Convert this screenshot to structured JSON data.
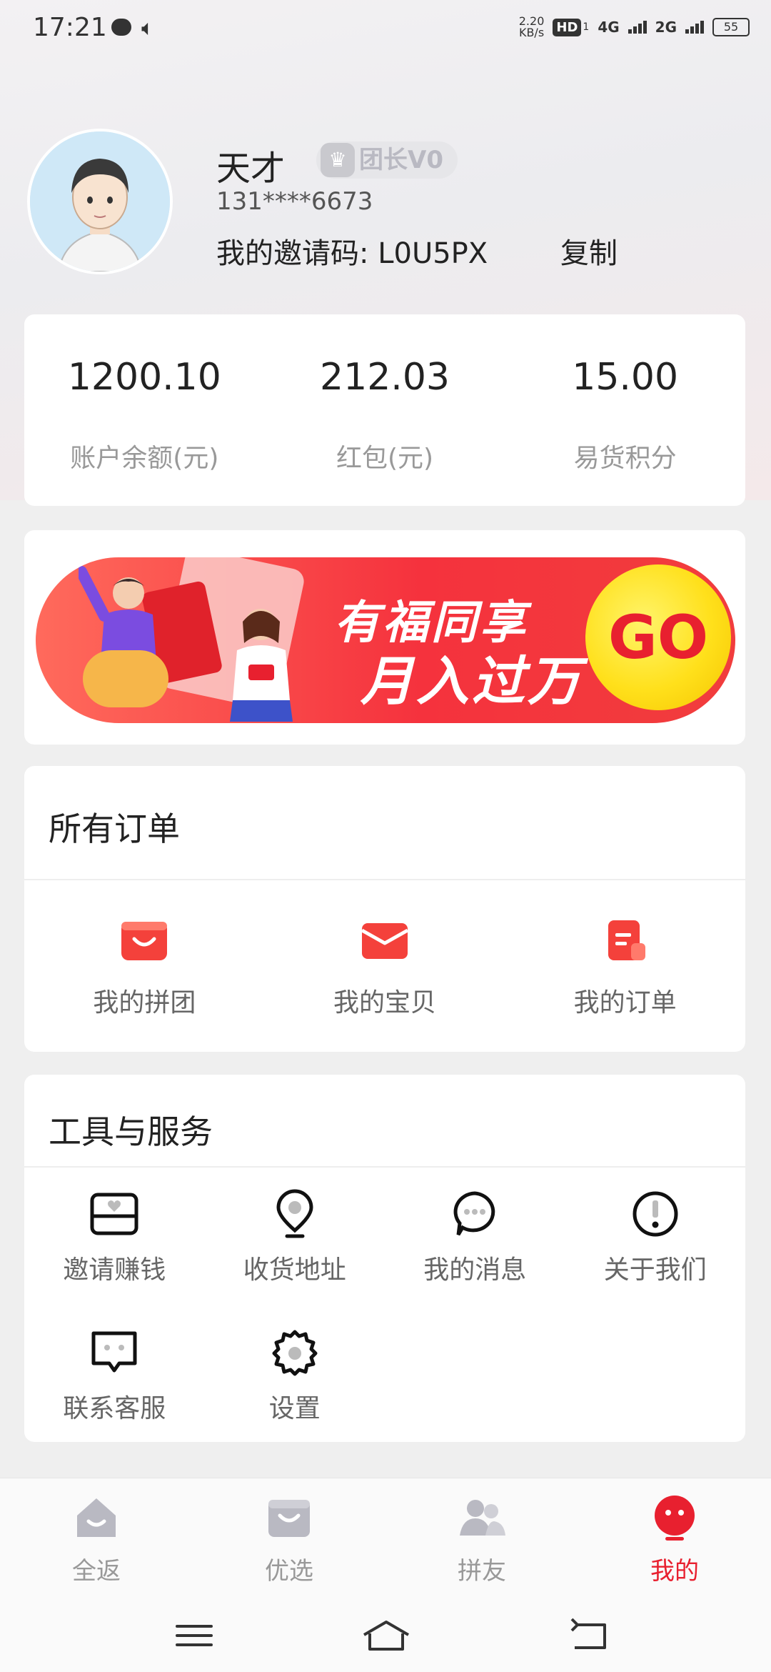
{
  "status_bar": {
    "time": "17:21",
    "net_speed": "2.20",
    "net_unit": "KB/s",
    "hd": "HD",
    "sim1": "1",
    "net_4g": "4G",
    "net_2g": "2G",
    "battery": "55"
  },
  "profile": {
    "name": "天才",
    "level_badge": "团长V0",
    "phone": "131****6673",
    "invite_label": "我的邀请码:",
    "invite_code": "L0U5PX",
    "copy_label": "复制"
  },
  "stats": [
    {
      "value": "1200.10",
      "label": "账户余额(元)"
    },
    {
      "value": "212.03",
      "label": "红包(元)"
    },
    {
      "value": "15.00",
      "label": "易货积分"
    }
  ],
  "banner": {
    "line1": "有福同享",
    "line2": "月入过万",
    "go": "GO"
  },
  "orders": {
    "title": "所有订单",
    "items": [
      {
        "label": "我的拼团",
        "icon": "group-buy-bag-icon"
      },
      {
        "label": "我的宝贝",
        "icon": "treasure-box-icon"
      },
      {
        "label": "我的订单",
        "icon": "order-list-icon"
      }
    ]
  },
  "tools": {
    "title": "工具与服务",
    "items": [
      {
        "label": "邀请赚钱",
        "icon": "invite-envelope-icon"
      },
      {
        "label": "收货地址",
        "icon": "location-pin-icon"
      },
      {
        "label": "我的消息",
        "icon": "message-bubble-icon"
      },
      {
        "label": "关于我们",
        "icon": "info-exclamation-icon"
      },
      {
        "label": "联系客服",
        "icon": "customer-service-icon"
      },
      {
        "label": "设置",
        "icon": "settings-gear-icon"
      }
    ]
  },
  "nav": {
    "items": [
      {
        "label": "全返",
        "icon": "home-icon"
      },
      {
        "label": "优选",
        "icon": "shopping-bag-icon"
      },
      {
        "label": "拼友",
        "icon": "friends-icon"
      },
      {
        "label": "我的",
        "icon": "profile-face-icon"
      }
    ],
    "active": "我的"
  },
  "colors": {
    "accent": "#e8202f",
    "icon_red": "#f4413b",
    "muted": "#999999"
  }
}
